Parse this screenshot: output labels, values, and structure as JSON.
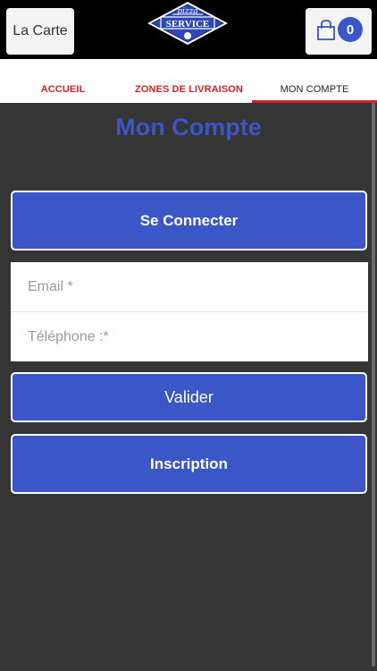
{
  "header": {
    "menu_label": "La Carte",
    "logo_text": "SERVICE",
    "logo_script": "pizza",
    "cart_count": "0"
  },
  "nav": {
    "tabs": [
      {
        "label": "ACCUEIL",
        "active": false
      },
      {
        "label": "ZONES DE LIVRAISON",
        "active": false
      },
      {
        "label": "MON COMPTE",
        "active": true
      }
    ]
  },
  "main": {
    "title": "Mon Compte",
    "connect_label": "Se Connecter",
    "email_placeholder": "Email *",
    "phone_placeholder": "Téléphone :*",
    "validate_label": "Valider",
    "signup_label": "Inscription"
  },
  "colors": {
    "accent_blue": "#3b56c6",
    "accent_red": "#d42424",
    "background": "#353535"
  }
}
